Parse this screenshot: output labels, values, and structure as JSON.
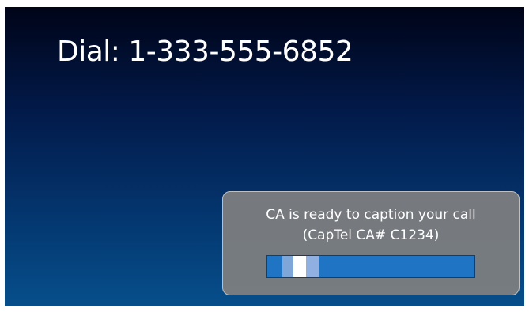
{
  "dial": {
    "text": "Dial: 1-333-555-6852"
  },
  "status": {
    "line1": "CA is ready to caption your call",
    "line2": "(CapTel CA# C1234)"
  },
  "progress": {
    "indicator_position": 0.09
  },
  "colors": {
    "background_top": "#000418",
    "background_bottom": "#064f8b",
    "panel": "#808080",
    "progress_track": "#1f74c4",
    "text": "#ffffff"
  }
}
